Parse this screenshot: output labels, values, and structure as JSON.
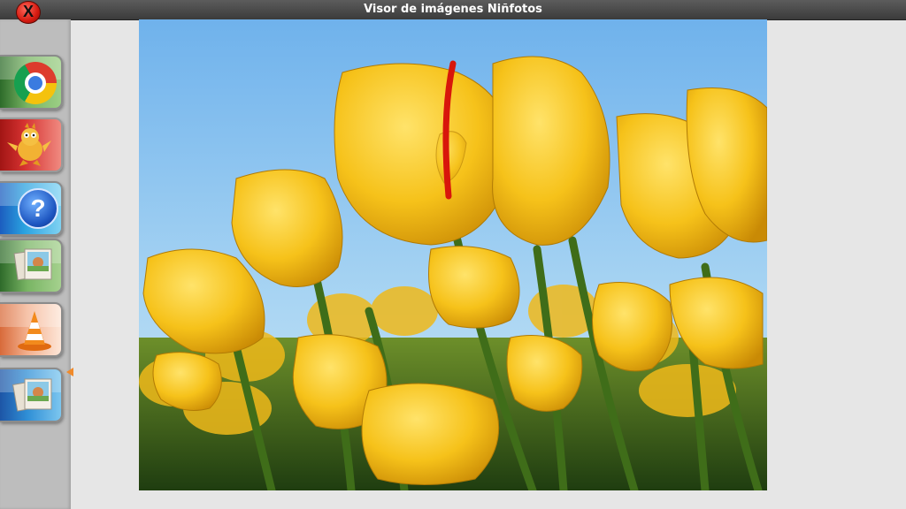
{
  "window": {
    "title": "Visor de imágenes Niñfotos",
    "close_label": "X"
  },
  "sidebar": {
    "items": [
      {
        "name": "chrome",
        "icon": "chrome-icon"
      },
      {
        "name": "game",
        "icon": "dragon-icon"
      },
      {
        "name": "help",
        "icon": "help-icon",
        "glyph": "?"
      },
      {
        "name": "photos",
        "icon": "photos-icon"
      },
      {
        "name": "vlc",
        "icon": "vlc-cone-icon"
      },
      {
        "name": "photo-viewer",
        "icon": "photos-icon",
        "active": true
      }
    ]
  },
  "viewer": {
    "image_subject": "yellow-tulips"
  },
  "colors": {
    "titlebar": "#4a4a4a",
    "sidebar": "#bdbdbd",
    "background": "#e6e6e6",
    "sky": "#8fc6ef",
    "tulip": "#f6c21a",
    "active_marker": "#f08a2a"
  }
}
